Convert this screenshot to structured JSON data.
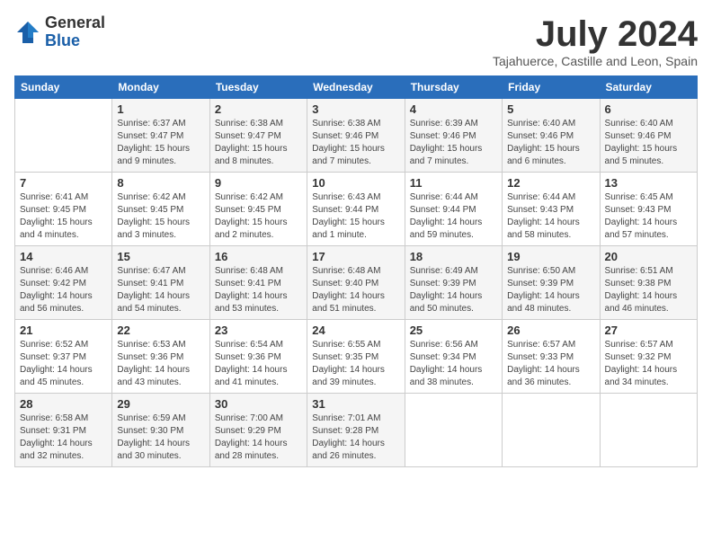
{
  "logo": {
    "general": "General",
    "blue": "Blue"
  },
  "title": "July 2024",
  "location": "Tajahuerce, Castille and Leon, Spain",
  "headers": [
    "Sunday",
    "Monday",
    "Tuesday",
    "Wednesday",
    "Thursday",
    "Friday",
    "Saturday"
  ],
  "weeks": [
    [
      {
        "day": "",
        "info": ""
      },
      {
        "day": "1",
        "info": "Sunrise: 6:37 AM\nSunset: 9:47 PM\nDaylight: 15 hours\nand 9 minutes."
      },
      {
        "day": "2",
        "info": "Sunrise: 6:38 AM\nSunset: 9:47 PM\nDaylight: 15 hours\nand 8 minutes."
      },
      {
        "day": "3",
        "info": "Sunrise: 6:38 AM\nSunset: 9:46 PM\nDaylight: 15 hours\nand 7 minutes."
      },
      {
        "day": "4",
        "info": "Sunrise: 6:39 AM\nSunset: 9:46 PM\nDaylight: 15 hours\nand 7 minutes."
      },
      {
        "day": "5",
        "info": "Sunrise: 6:40 AM\nSunset: 9:46 PM\nDaylight: 15 hours\nand 6 minutes."
      },
      {
        "day": "6",
        "info": "Sunrise: 6:40 AM\nSunset: 9:46 PM\nDaylight: 15 hours\nand 5 minutes."
      }
    ],
    [
      {
        "day": "7",
        "info": "Sunrise: 6:41 AM\nSunset: 9:45 PM\nDaylight: 15 hours\nand 4 minutes."
      },
      {
        "day": "8",
        "info": "Sunrise: 6:42 AM\nSunset: 9:45 PM\nDaylight: 15 hours\nand 3 minutes."
      },
      {
        "day": "9",
        "info": "Sunrise: 6:42 AM\nSunset: 9:45 PM\nDaylight: 15 hours\nand 2 minutes."
      },
      {
        "day": "10",
        "info": "Sunrise: 6:43 AM\nSunset: 9:44 PM\nDaylight: 15 hours\nand 1 minute."
      },
      {
        "day": "11",
        "info": "Sunrise: 6:44 AM\nSunset: 9:44 PM\nDaylight: 14 hours\nand 59 minutes."
      },
      {
        "day": "12",
        "info": "Sunrise: 6:44 AM\nSunset: 9:43 PM\nDaylight: 14 hours\nand 58 minutes."
      },
      {
        "day": "13",
        "info": "Sunrise: 6:45 AM\nSunset: 9:43 PM\nDaylight: 14 hours\nand 57 minutes."
      }
    ],
    [
      {
        "day": "14",
        "info": "Sunrise: 6:46 AM\nSunset: 9:42 PM\nDaylight: 14 hours\nand 56 minutes."
      },
      {
        "day": "15",
        "info": "Sunrise: 6:47 AM\nSunset: 9:41 PM\nDaylight: 14 hours\nand 54 minutes."
      },
      {
        "day": "16",
        "info": "Sunrise: 6:48 AM\nSunset: 9:41 PM\nDaylight: 14 hours\nand 53 minutes."
      },
      {
        "day": "17",
        "info": "Sunrise: 6:48 AM\nSunset: 9:40 PM\nDaylight: 14 hours\nand 51 minutes."
      },
      {
        "day": "18",
        "info": "Sunrise: 6:49 AM\nSunset: 9:39 PM\nDaylight: 14 hours\nand 50 minutes."
      },
      {
        "day": "19",
        "info": "Sunrise: 6:50 AM\nSunset: 9:39 PM\nDaylight: 14 hours\nand 48 minutes."
      },
      {
        "day": "20",
        "info": "Sunrise: 6:51 AM\nSunset: 9:38 PM\nDaylight: 14 hours\nand 46 minutes."
      }
    ],
    [
      {
        "day": "21",
        "info": "Sunrise: 6:52 AM\nSunset: 9:37 PM\nDaylight: 14 hours\nand 45 minutes."
      },
      {
        "day": "22",
        "info": "Sunrise: 6:53 AM\nSunset: 9:36 PM\nDaylight: 14 hours\nand 43 minutes."
      },
      {
        "day": "23",
        "info": "Sunrise: 6:54 AM\nSunset: 9:36 PM\nDaylight: 14 hours\nand 41 minutes."
      },
      {
        "day": "24",
        "info": "Sunrise: 6:55 AM\nSunset: 9:35 PM\nDaylight: 14 hours\nand 39 minutes."
      },
      {
        "day": "25",
        "info": "Sunrise: 6:56 AM\nSunset: 9:34 PM\nDaylight: 14 hours\nand 38 minutes."
      },
      {
        "day": "26",
        "info": "Sunrise: 6:57 AM\nSunset: 9:33 PM\nDaylight: 14 hours\nand 36 minutes."
      },
      {
        "day": "27",
        "info": "Sunrise: 6:57 AM\nSunset: 9:32 PM\nDaylight: 14 hours\nand 34 minutes."
      }
    ],
    [
      {
        "day": "28",
        "info": "Sunrise: 6:58 AM\nSunset: 9:31 PM\nDaylight: 14 hours\nand 32 minutes."
      },
      {
        "day": "29",
        "info": "Sunrise: 6:59 AM\nSunset: 9:30 PM\nDaylight: 14 hours\nand 30 minutes."
      },
      {
        "day": "30",
        "info": "Sunrise: 7:00 AM\nSunset: 9:29 PM\nDaylight: 14 hours\nand 28 minutes."
      },
      {
        "day": "31",
        "info": "Sunrise: 7:01 AM\nSunset: 9:28 PM\nDaylight: 14 hours\nand 26 minutes."
      },
      {
        "day": "",
        "info": ""
      },
      {
        "day": "",
        "info": ""
      },
      {
        "day": "",
        "info": ""
      }
    ]
  ]
}
